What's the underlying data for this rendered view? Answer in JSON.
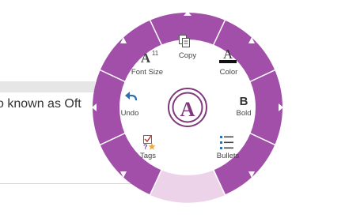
{
  "document": {
    "text": "o known as Oft"
  },
  "radial_menu": {
    "center": {
      "letter": "A",
      "icon": "onenote-a-logo-icon"
    },
    "items": [
      {
        "label": "Copy",
        "icon": "copy-icon"
      },
      {
        "label": "Font Size",
        "icon": "font-size-icon",
        "glyph": "A",
        "superscript": "11"
      },
      {
        "label": "Color",
        "icon": "font-color-icon",
        "glyph": "A"
      },
      {
        "label": "Undo",
        "icon": "undo-icon"
      },
      {
        "label": "Bold",
        "icon": "bold-icon",
        "glyph": "B"
      },
      {
        "label": "Tags",
        "icon": "tags-icon"
      },
      {
        "label": "Bullets",
        "icon": "bullets-icon"
      }
    ],
    "colors": {
      "ring": "#a14fa8",
      "ring_highlight": "#ecd3ea",
      "accent": "#80397b"
    }
  }
}
